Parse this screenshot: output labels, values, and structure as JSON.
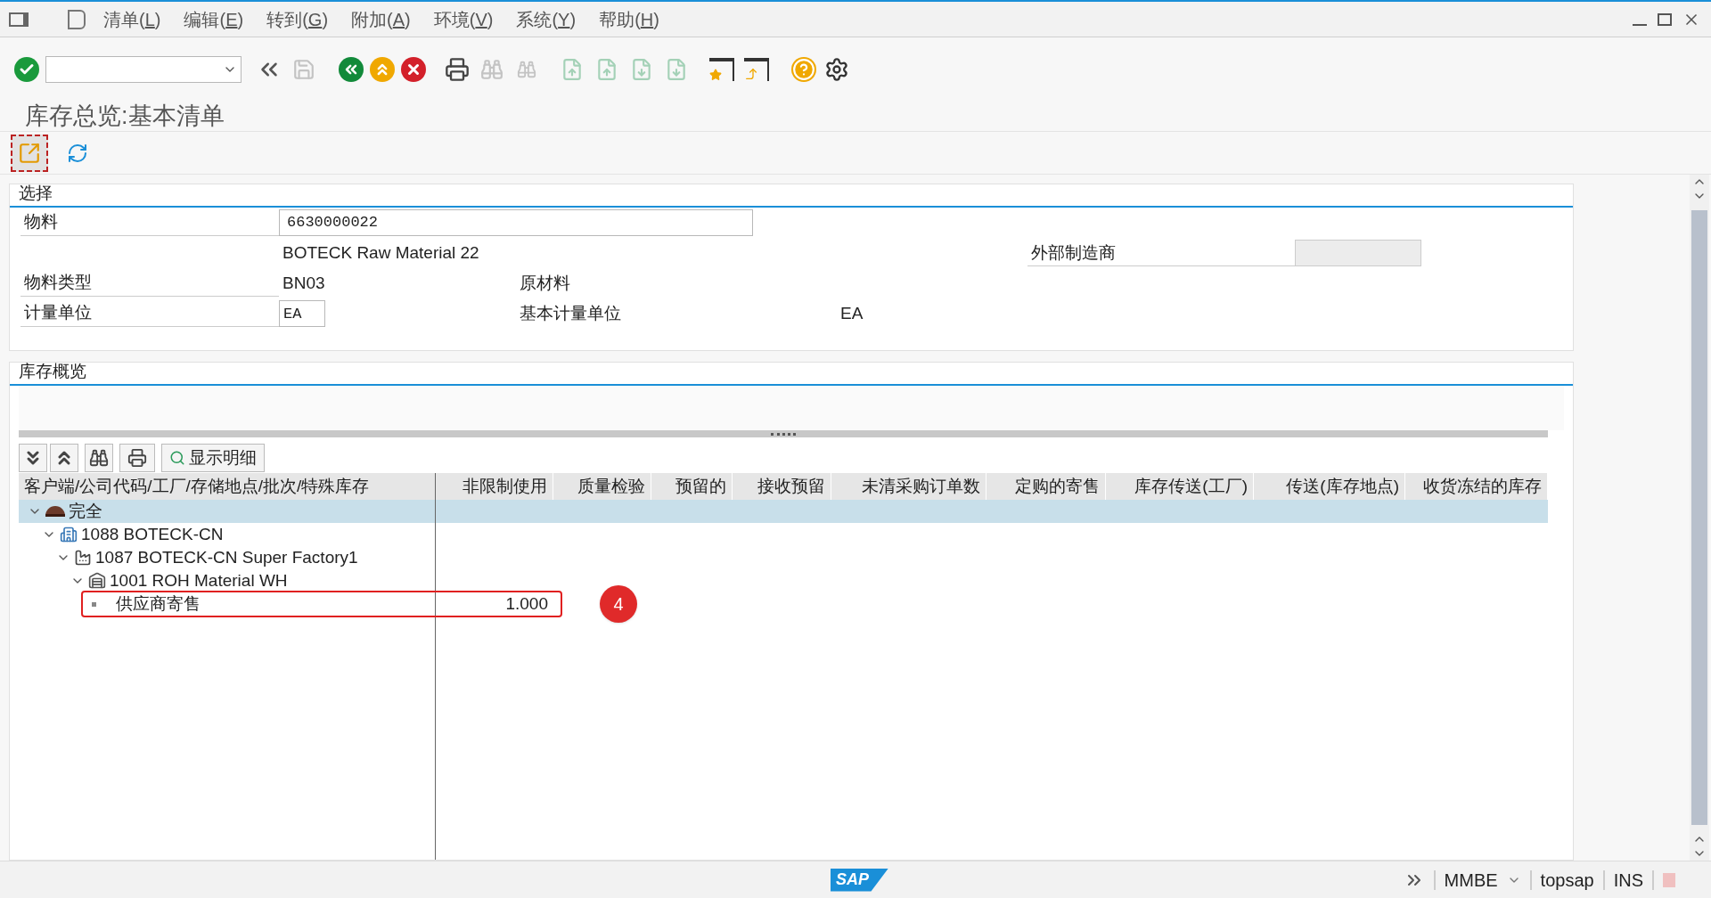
{
  "menu_bar": [
    {
      "text": "清单(L)"
    },
    {
      "text": "编辑(E)"
    },
    {
      "text": "转到(G)"
    },
    {
      "text": "附加(A)"
    },
    {
      "text": "环境(V)"
    },
    {
      "text": "系统(Y)"
    },
    {
      "text": "帮助(H)"
    }
  ],
  "toolbar": [
    {
      "kind": "enter",
      "disabled": false
    },
    {
      "kind": "command-field",
      "disabled": false
    },
    {
      "kind": "collapse",
      "disabled": false
    },
    {
      "kind": "save",
      "disabled": true
    },
    {
      "kind": "back",
      "disabled": false
    },
    {
      "kind": "exit",
      "disabled": false
    },
    {
      "kind": "cancel",
      "disabled": false
    },
    {
      "kind": "print",
      "disabled": false
    },
    {
      "kind": "find",
      "disabled": true
    },
    {
      "kind": "find-next",
      "disabled": true
    },
    {
      "kind": "first-page",
      "disabled": true
    },
    {
      "kind": "prev-page",
      "disabled": true
    },
    {
      "kind": "next-page",
      "disabled": true
    },
    {
      "kind": "last-page",
      "disabled": true
    },
    {
      "kind": "bookmark",
      "disabled": false
    },
    {
      "kind": "shortcut",
      "disabled": false
    },
    {
      "kind": "help",
      "disabled": false
    },
    {
      "kind": "settings",
      "disabled": false
    }
  ],
  "title": "库存总览:基本清单",
  "app_toolbar": [
    {
      "kind": "export",
      "selected": true
    },
    {
      "kind": "refresh",
      "selected": false
    }
  ],
  "selection": {
    "heading": "选择",
    "material_label": "物料",
    "material_value": "6630000022",
    "material_description": "BOTECK Raw Material 22",
    "manufacturer_label": "外部制造商",
    "material_type_label": "物料类型",
    "material_type_value": "BN03",
    "material_type_text": "原材料",
    "unit_label": "计量单位",
    "unit_value": "EA",
    "base_unit_label": "基本计量单位",
    "base_unit_value": "EA"
  },
  "overview": {
    "heading": "库存概览",
    "alv_toolbar": [
      {
        "kind": "expand-all"
      },
      {
        "kind": "collapse-all"
      },
      {
        "kind": "find"
      },
      {
        "kind": "print"
      },
      {
        "kind": "details",
        "text": "显示明细"
      }
    ],
    "columns": [
      "客户端/公司代码/工厂/存储地点/批次/特殊库存",
      "非限制使用",
      "质量检验",
      "预留的",
      "接收预留",
      "未清采购订单数",
      "定购的寄售",
      "库存传送(工厂)",
      "传送(库存地点)",
      "收货冻结的库存"
    ],
    "tree": [
      {
        "label": "完全",
        "kind": "hat",
        "expanded": true,
        "selected": true,
        "children": [
          {
            "label": "1088 BOTECK-CN",
            "kind": "company",
            "expanded": true,
            "selected": false,
            "children": [
              {
                "label": "1087 BOTECK-CN Super Factory1",
                "kind": "factory",
                "expanded": true,
                "selected": false,
                "children": [
                  {
                    "label": "1001 ROH Material WH",
                    "kind": "warehouse",
                    "expanded": true,
                    "selected": false,
                    "children": [
                      {
                        "label": "供应商寄售",
                        "kind": "leaf",
                        "selected": false,
                        "values": [
                          "1.000"
                        ],
                        "annotation": "4"
                      }
                    ]
                  }
                ]
              }
            ]
          }
        ]
      }
    ]
  },
  "status_bar": {
    "logo": "SAP",
    "transaction": "MMBE",
    "user": "topsap",
    "mode": "INS"
  }
}
